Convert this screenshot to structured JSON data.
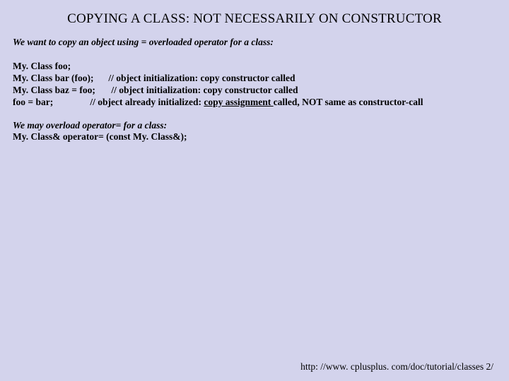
{
  "title": "COPYING A CLASS: NOT NECESSARILY ON CONSTRUCTOR",
  "intro": "We want to copy an object using  =  overloaded operator for a class:",
  "code": {
    "l1": {
      "lhs": "My. Class  foo;"
    },
    "l2": {
      "lhs": "My. Class  bar (foo);",
      "cmt": "// object initialization: copy constructor called"
    },
    "l3": {
      "lhs": "My. Class  baz = foo;",
      "cmt": "// object initialization: copy constructor called"
    },
    "l4": {
      "lhs": "foo = bar;",
      "cmt_pre": "// object already initialized: ",
      "cmt_u": "copy assignment ",
      "cmt_post": "called, NOT same as constructor-call"
    }
  },
  "overload": {
    "ln1": "We may overload operator=  for a class:",
    "ln2": "My. Class&  operator=  (const My. Class&);"
  },
  "footer_url": "http: //www. cplusplus. com/doc/tutorial/classes 2/"
}
